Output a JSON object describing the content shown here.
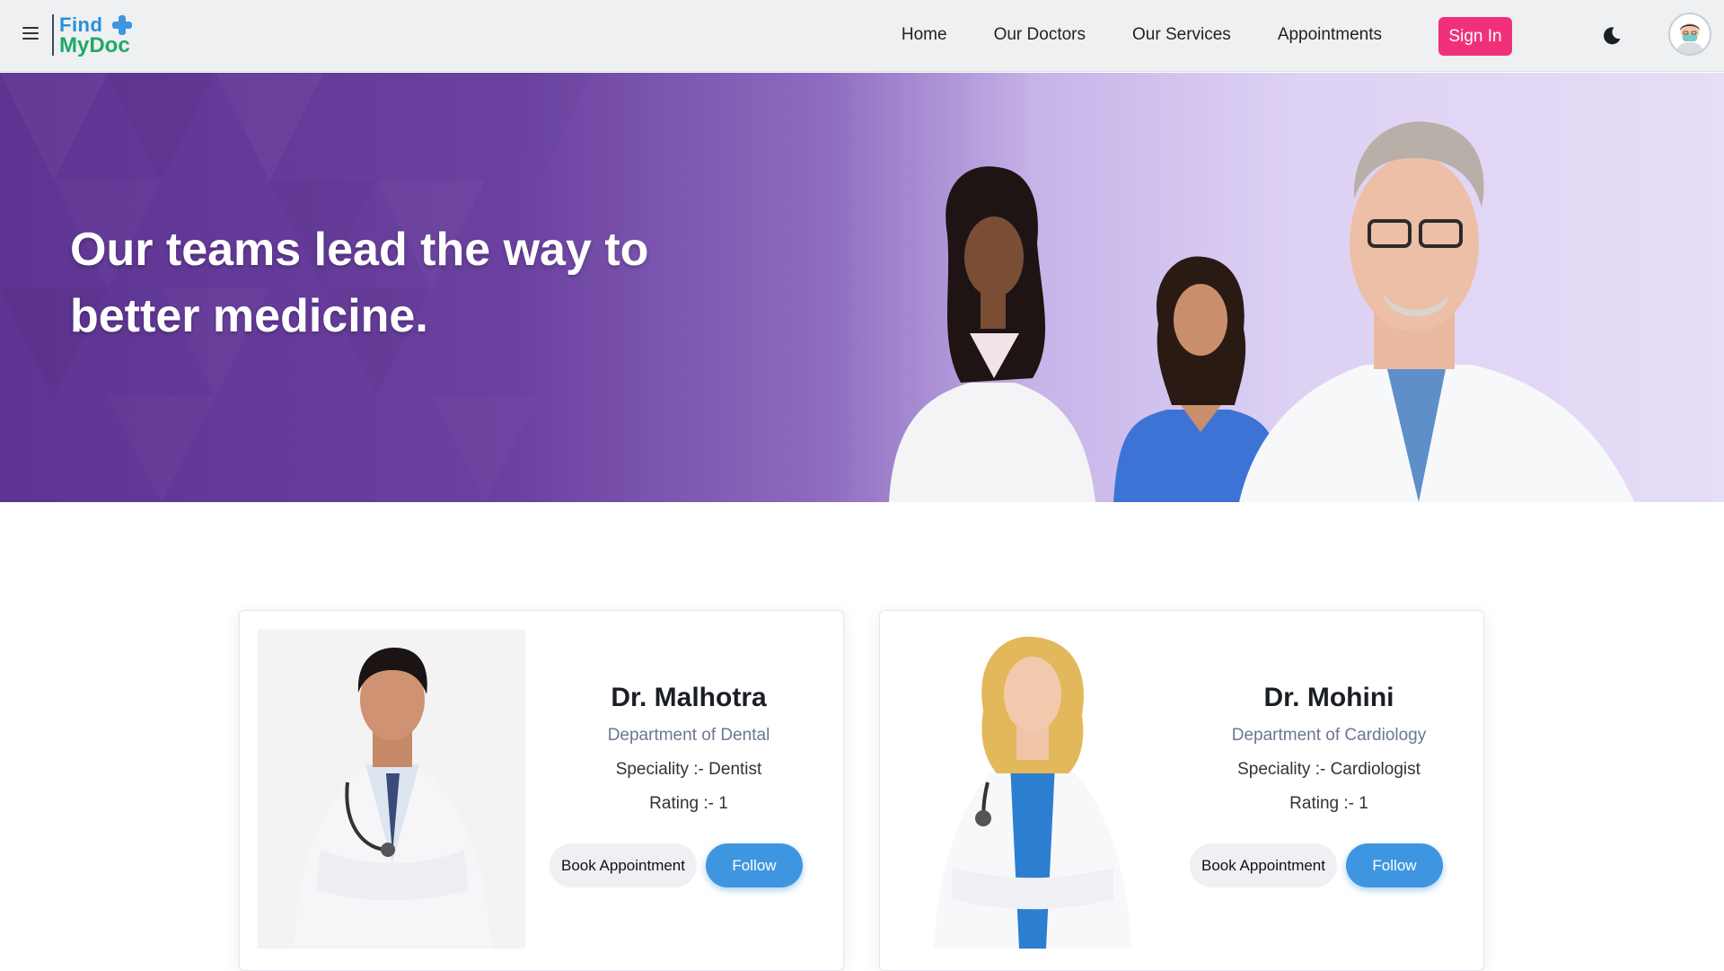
{
  "brand": {
    "line1": "Find",
    "line2": "MyDoc"
  },
  "nav": {
    "items": [
      "Home",
      "Our Doctors",
      "Our Services",
      "Appointments"
    ],
    "signin_label": "Sign In"
  },
  "hero": {
    "title_line1": "Our teams lead the way to",
    "title_line2": "better medicine."
  },
  "doctors": [
    {
      "name": "Dr. Malhotra",
      "department": "Department of Dental",
      "speciality": "Speciality :- Dentist",
      "rating": "Rating :- 1",
      "book_label": "Book Appointment",
      "follow_label": "Follow"
    },
    {
      "name": "Dr. Mohini",
      "department": "Department of Cardiology",
      "speciality": "Speciality :- Cardiologist",
      "rating": "Rating :- 1",
      "book_label": "Book Appointment",
      "follow_label": "Follow"
    }
  ],
  "colors": {
    "accent": "#f0317a",
    "follow": "#3f96e0",
    "hero_dark": "#5d3491",
    "hero_light": "#e6ddf6"
  },
  "icons": {
    "menu": "hamburger-menu-icon",
    "theme": "moon-icon",
    "profile": "user-avatar-icon"
  }
}
